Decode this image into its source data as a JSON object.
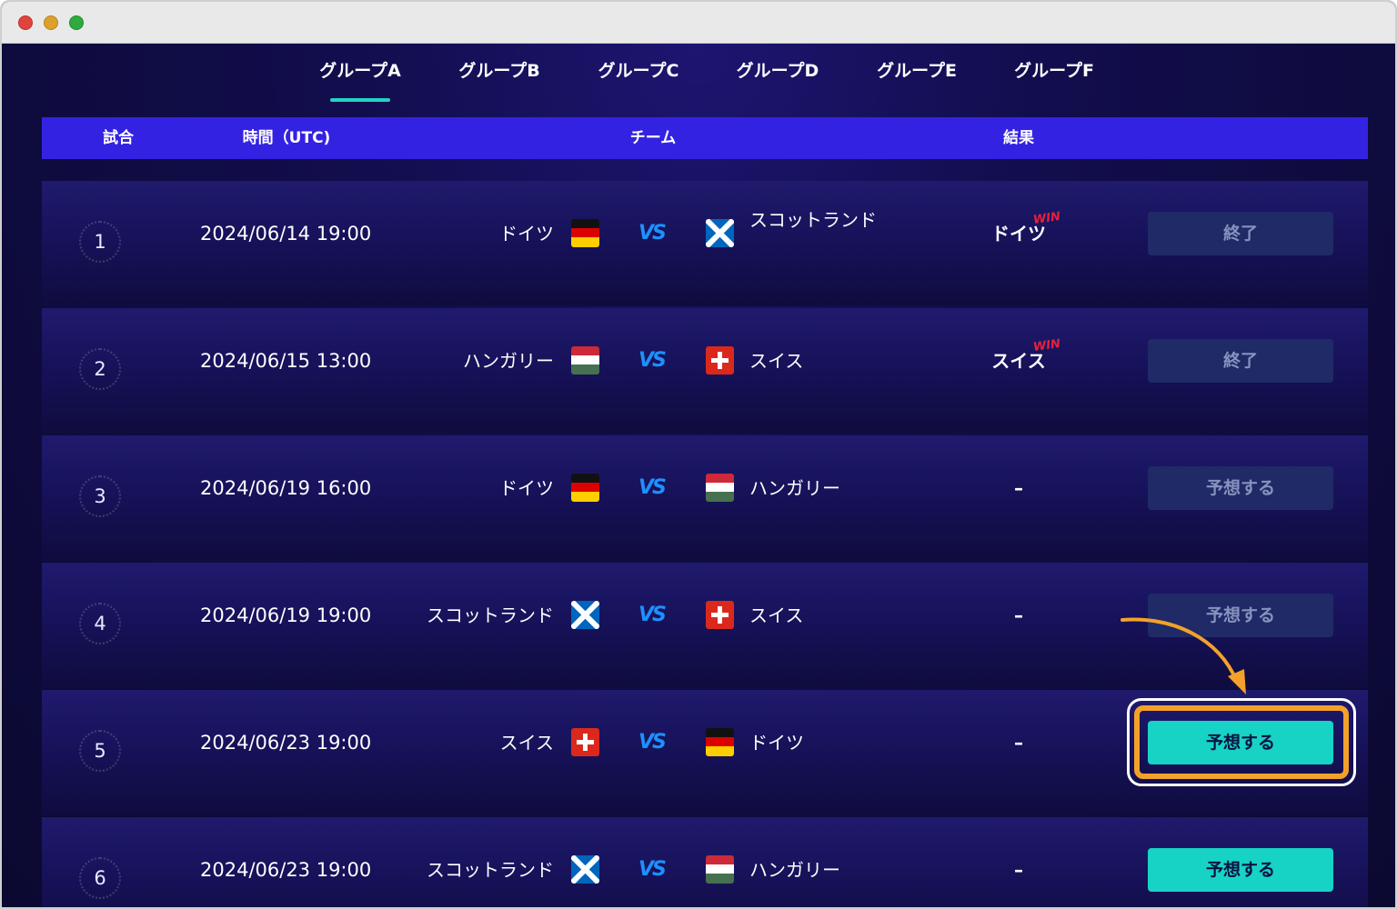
{
  "tabs": [
    "グループA",
    "グループB",
    "グループC",
    "グループD",
    "グループE",
    "グループF"
  ],
  "header": {
    "match": "試合",
    "time": "時間（UTC)",
    "team": "チーム",
    "result": "結果"
  },
  "vs_label": "VS",
  "win_label": "WIN",
  "matches": [
    {
      "num": "1",
      "time": "2024/06/14 19:00",
      "home": "ドイツ",
      "away": "スコットランド",
      "result": "ドイツ",
      "status": "終了"
    },
    {
      "num": "2",
      "time": "2024/06/15 13:00",
      "home": "ハンガリー",
      "away": "スイス",
      "result": "スイス",
      "status": "終了"
    },
    {
      "num": "3",
      "time": "2024/06/19 16:00",
      "home": "ドイツ",
      "away": "ハンガリー",
      "result": "–",
      "status": "予想する"
    },
    {
      "num": "4",
      "time": "2024/06/19 19:00",
      "home": "スコットランド",
      "away": "スイス",
      "result": "–",
      "status": "予想する"
    },
    {
      "num": "5",
      "time": "2024/06/23 19:00",
      "home": "スイス",
      "away": "ドイツ",
      "result": "–",
      "status": "予想する"
    },
    {
      "num": "6",
      "time": "2024/06/23 19:00",
      "home": "スコットランド",
      "away": "ハンガリー",
      "result": "–",
      "status": "予想する"
    }
  ],
  "colors": {
    "accent": "#16d3c6",
    "header": "#3422e2",
    "highlight": "#f3a12a",
    "win": "#e8203a"
  }
}
